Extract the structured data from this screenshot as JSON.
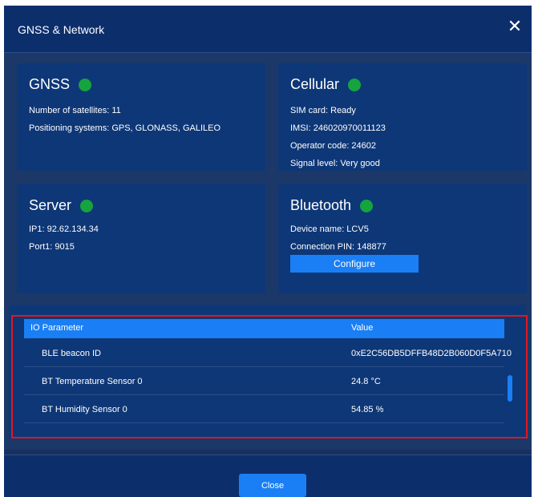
{
  "dialog": {
    "title": "GNSS & Network",
    "close_glyph": "✕"
  },
  "gnss": {
    "title": "GNSS",
    "status_color": "#15a43d",
    "lines": [
      "Number of satellites: 11",
      "Positioning systems: GPS, GLONASS, GALILEO"
    ]
  },
  "cellular": {
    "title": "Cellular",
    "status_color": "#15a43d",
    "lines": [
      "SIM card: Ready",
      "IMSI: 246020970011123",
      "Operator code: 24602",
      "Signal level: Very good"
    ]
  },
  "server": {
    "title": "Server",
    "status_color": "#15a43d",
    "lines": [
      "IP1: 92.62.134.34",
      "Port1: 9015"
    ]
  },
  "bluetooth": {
    "title": "Bluetooth",
    "status_color": "#15a43d",
    "lines": [
      "Device name: LCV5",
      "Connection PIN: 148877"
    ],
    "configure_label": "Configure"
  },
  "io_table": {
    "headers": [
      "IO Parameter",
      "Value"
    ],
    "rows": [
      [
        "BLE beacon ID",
        "0xE2C56DB5DFFB48D2B060D0F5A710"
      ],
      [
        "BT Temperature Sensor 0",
        "24.8 °C"
      ],
      [
        "BT Humidity Sensor 0",
        "54.85 %"
      ]
    ]
  },
  "footer": {
    "close_label": "Close"
  },
  "colors": {
    "accent": "#1a7ff5",
    "highlight": "#e3161e",
    "ok": "#15a43d"
  }
}
